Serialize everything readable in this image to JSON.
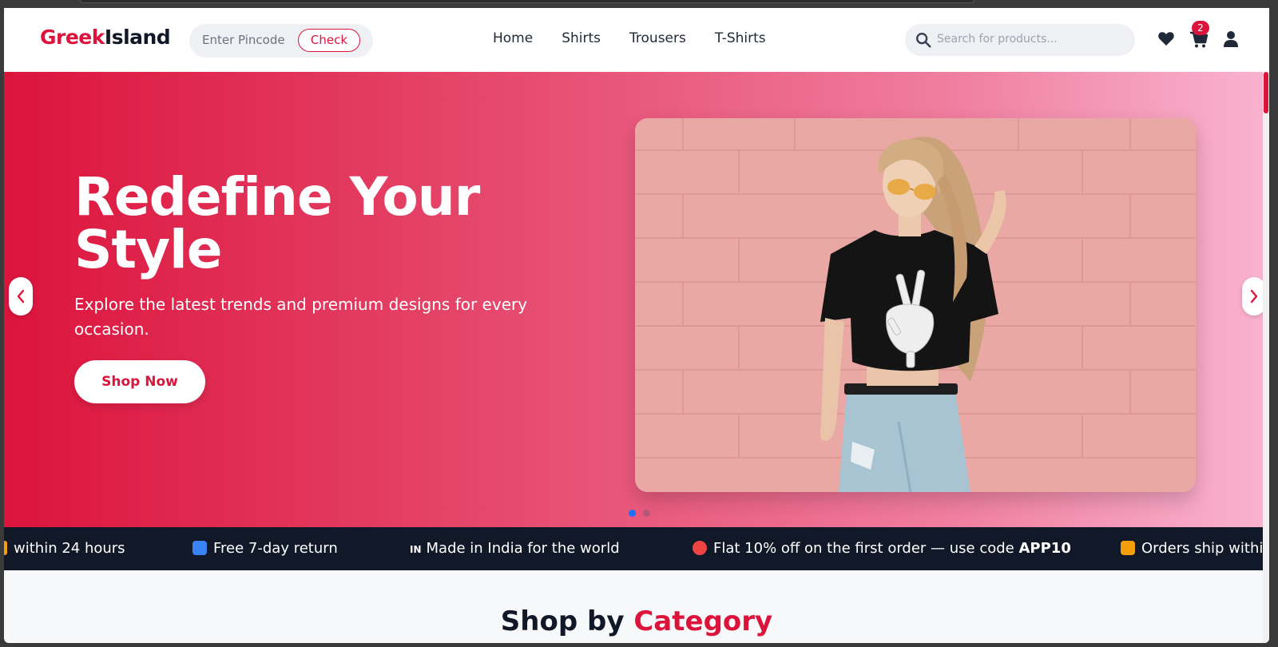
{
  "header": {
    "logo_part1": "Greek",
    "logo_part2": "Island",
    "pincode_placeholder": "Enter Pincode",
    "check_label": "Check",
    "nav": [
      "Home",
      "Shirts",
      "Trousers",
      "T-Shirts"
    ],
    "search_placeholder": "Search for products...",
    "cart_count": "2",
    "icons": [
      "search-icon",
      "heart-icon",
      "cart-icon",
      "user-icon"
    ]
  },
  "hero": {
    "title": "Redefine Your Style",
    "subtitle": "Explore the latest trends and premium designs for every occasion.",
    "button_label": "Shop Now",
    "slides_total": 2,
    "active_slide": 1
  },
  "ticker": {
    "items": [
      "within 24 hours",
      "Free 7-day return",
      "Made in India for the world",
      "Flat 10% off on the first order — use code ",
      "Orders ship within"
    ],
    "code": "APP10",
    "india_mark": "IN"
  },
  "section": {
    "title_part1": "Shop by ",
    "title_part2": "Category"
  },
  "colors": {
    "brand": "#dc143c",
    "dark": "#111827"
  }
}
